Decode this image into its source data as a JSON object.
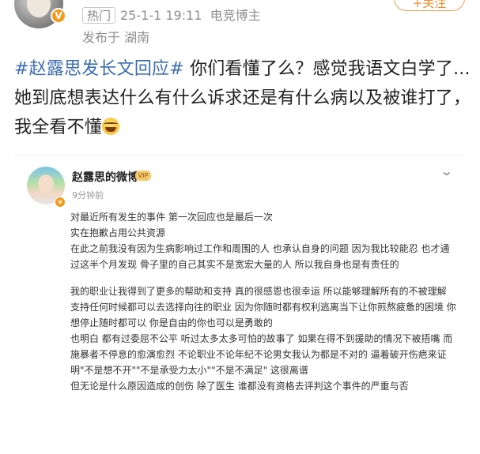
{
  "post": {
    "hot_badge": "热门",
    "timestamp": "25-1-1 19:11",
    "source": "电竞博主",
    "location": "发布于 湖南",
    "follow_label": "+关注",
    "hashtag": "#赵露思发长文回应#",
    "text_after_hashtag": " 你们看懂了么？感觉我语文白学了...她到底想表达什么有什么诉求还是有什么病以及被谁打了，我全看不懂",
    "emoji": "laughing-crying-emoji"
  },
  "screenshot": {
    "username": "赵露思的微博",
    "vip_label": "VIP",
    "time_ago": "9分钟前",
    "paragraphs": [
      [
        "对最近所有发生的事件 第一次回应也是最后一次",
        "实在抱歉占用公共资源",
        "在此之前我没有因为生病影响过工作和周围的人 也承认自身的问题 因为我比较能忍 也才通过这半个月发现 骨子里的自己其实不是宽宏大量的人  所以我自身也是有责任的"
      ],
      [
        "我的职业让我得到了更多的帮助和支持 真的很感恩也很幸运 所以能够理解所有的不被理解",
        "支持任何时候都可以去选择向往的职业 因为你随时都有权利逃离当下让你煎熬疲惫的困境 你想停止随时都可以 你是自由的你也可以是勇敢的",
        "也明白 都有过委屈不公平 听过太多太多可怕的故事了 如果在得不到援助的情况下被捂嘴 而施暴者不停息的愈演愈烈 不论职业不论年纪不论男女我认为都是不对的 逼着破开伤疤来证明\"不是想不开\"\"不是承受力太小\"\"不是不满足\" 这很离谱",
        "但无论是什么原因造成的创伤 除了医生 谁都没有资格去评判这个事件的严重与否"
      ]
    ]
  }
}
